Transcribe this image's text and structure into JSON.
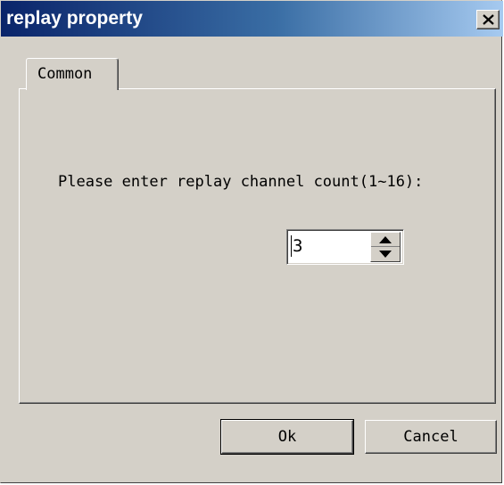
{
  "window": {
    "title": "replay property"
  },
  "tabs": [
    {
      "label": "Common",
      "selected": true
    }
  ],
  "form": {
    "prompt": "Please enter replay channel count(1~16):",
    "channel_count_value": "3"
  },
  "buttons": {
    "ok_label": "Ok",
    "cancel_label": "Cancel"
  },
  "icons": {
    "close": "close-icon",
    "spin_up": "arrow-up-icon",
    "spin_down": "arrow-down-icon"
  },
  "colors": {
    "titlebar_start": "#0a246a",
    "titlebar_end": "#a6caf0",
    "face": "#d4d0c8"
  }
}
